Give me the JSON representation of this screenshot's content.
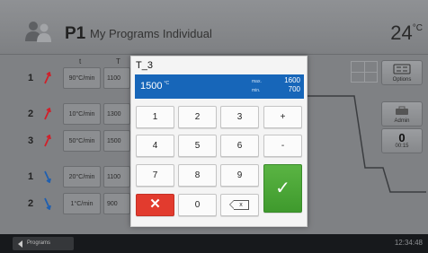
{
  "header": {
    "program_number": "P1",
    "program_name": "My Programs Individual",
    "temperature": "24",
    "temperature_unit": "°C"
  },
  "table": {
    "columns": [
      "t",
      "T"
    ],
    "rows": [
      {
        "num": "1",
        "direction": "up",
        "rate": "90°C/min",
        "target": "1100"
      },
      {
        "num": "2",
        "direction": "up",
        "rate": "10°C/min",
        "target": "1300"
      },
      {
        "num": "3",
        "direction": "up",
        "rate": "50°C/min",
        "target": "1500"
      },
      {
        "num": "1",
        "direction": "down",
        "rate": "20°C/min",
        "target": "1100"
      },
      {
        "num": "2",
        "direction": "down",
        "rate": "1°C/min",
        "target": "900"
      }
    ]
  },
  "side": {
    "options_label": "Options",
    "admin_label": "Admin",
    "timer_value": "0",
    "timer_time": "00:15"
  },
  "dialog": {
    "title": "T_3",
    "value": "1500",
    "unit": "°C",
    "max_label": "max.",
    "max_value": "1600",
    "min_label": "min.",
    "min_value": "700",
    "keys": {
      "k1": "1",
      "k2": "2",
      "k3": "3",
      "plus": "+",
      "k4": "4",
      "k5": "5",
      "k6": "6",
      "minus": "-",
      "k7": "7",
      "k8": "8",
      "k9": "9",
      "cancel": "✕",
      "k0": "0",
      "backspace_x": "x",
      "ok": "✓"
    }
  },
  "footer": {
    "back_label": "Programs",
    "clock": "12:34:48"
  },
  "colors": {
    "value_box": "#1766b9",
    "cancel": "#e23b2e",
    "ok": "#4aa836",
    "arrow_up": "#d0202a",
    "arrow_down": "#1f5fb0"
  }
}
